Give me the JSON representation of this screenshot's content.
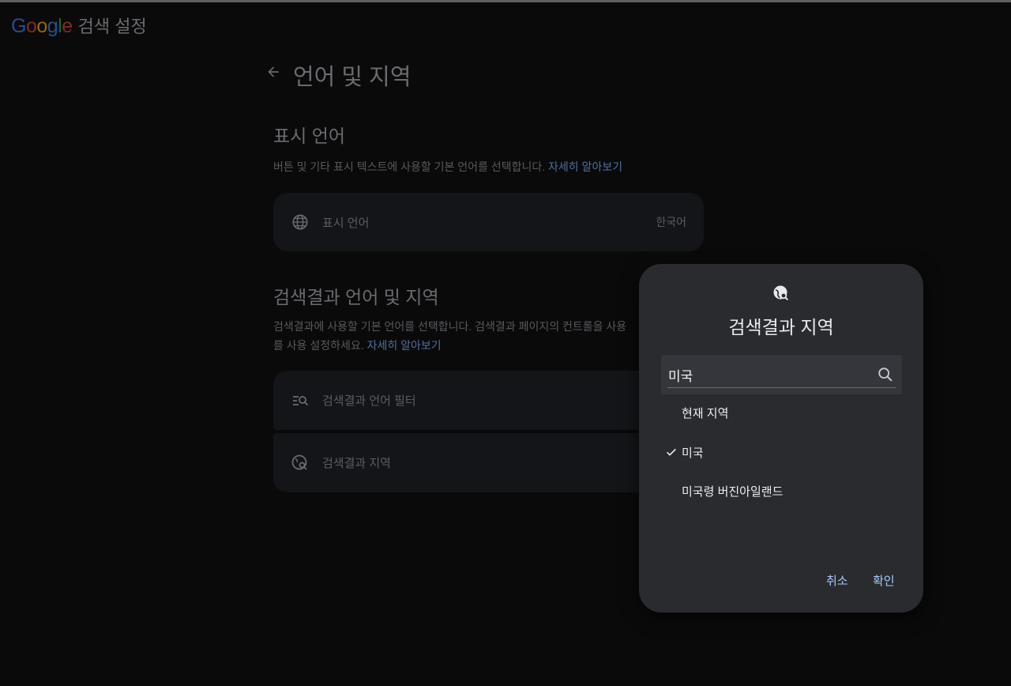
{
  "brand": {
    "logo_text": "Google",
    "subtitle": "검색 설정",
    "logo_colors": [
      "#4285f4",
      "#ea4335",
      "#fbbc05",
      "#4285f4",
      "#34a853",
      "#ea4335"
    ]
  },
  "page": {
    "title": "언어 및 지역",
    "back_icon": "arrow-left-icon"
  },
  "display_language": {
    "heading": "표시 언어",
    "description": "버튼 및 기타 표시 텍스트에 사용할 기본 언어를 선택합니다.",
    "learn_more": "자세히 알아보기",
    "row": {
      "icon": "globe-icon",
      "label": "표시 언어",
      "value": "한국어"
    }
  },
  "results_language_region": {
    "heading": "검색결과 언어 및 지역",
    "description_line1": "검색결과에 사용할 기본 언어를 선택합니다. 검색결과 페이지의 컨트롤을 사용",
    "description_line2": "를 사용 설정하세요.",
    "learn_more": "자세히 알아보기",
    "rows": [
      {
        "icon": "filter-search-icon",
        "label": "검색결과 언어 필터"
      },
      {
        "icon": "globe-search-icon",
        "label": "검색결과 지역"
      }
    ]
  },
  "dialog": {
    "icon": "globe-search-icon",
    "title": "검색결과 지역",
    "search_value": "미국",
    "options": [
      {
        "label": "현재 지역",
        "selected": false
      },
      {
        "label": "미국",
        "selected": true
      },
      {
        "label": "미국령 버진아일랜드",
        "selected": false
      }
    ],
    "cancel_label": "취소",
    "confirm_label": "확인",
    "accent": "#a8c7fa"
  }
}
